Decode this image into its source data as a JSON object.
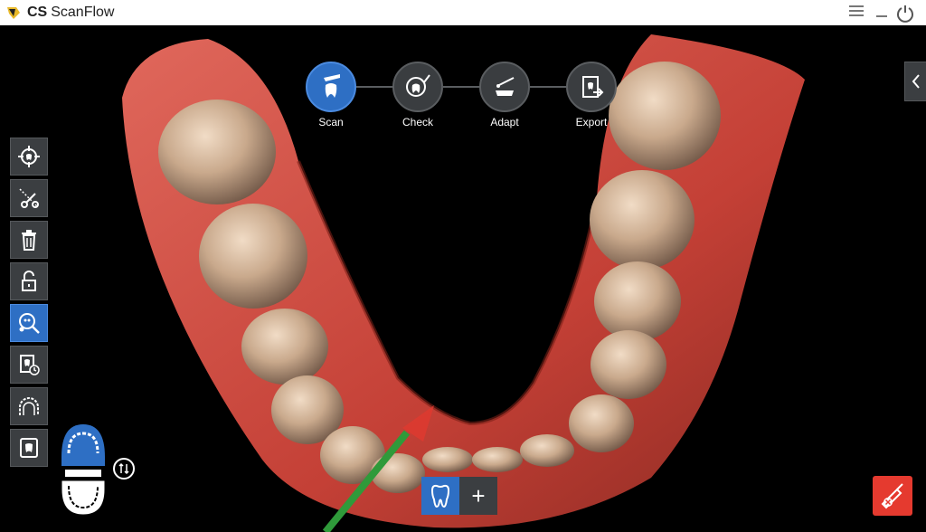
{
  "app": {
    "brand": "CS",
    "name": "ScanFlow"
  },
  "window_controls": [
    "menu-icon",
    "minimize-icon",
    "power-icon"
  ],
  "workflow": {
    "steps": [
      {
        "label": "Scan",
        "icon": "tooth-scan-icon",
        "active": true
      },
      {
        "label": "Check",
        "icon": "tooth-check-icon",
        "active": false
      },
      {
        "label": "Adapt",
        "icon": "arch-adapt-icon",
        "active": false
      },
      {
        "label": "Export",
        "icon": "export-icon",
        "active": false
      }
    ]
  },
  "toolbar": {
    "tools": [
      {
        "name": "target-icon",
        "active": false
      },
      {
        "name": "scissors-icon",
        "active": false
      },
      {
        "name": "trash-icon",
        "active": false
      },
      {
        "name": "unlock-icon",
        "active": false
      },
      {
        "name": "magnify-icon",
        "active": true
      },
      {
        "name": "tooth-history-icon",
        "active": false
      },
      {
        "name": "arch-icon",
        "active": false
      },
      {
        "name": "tooth-card-icon",
        "active": false
      }
    ]
  },
  "bottom": {
    "tooth_mode": "tooth-icon",
    "add": "+"
  },
  "colors": {
    "accent": "#2e6fc4",
    "danger": "#e53a2f",
    "panel": "#3b3e41",
    "gum": "#c9473f",
    "tooth": "#c9a98c"
  }
}
